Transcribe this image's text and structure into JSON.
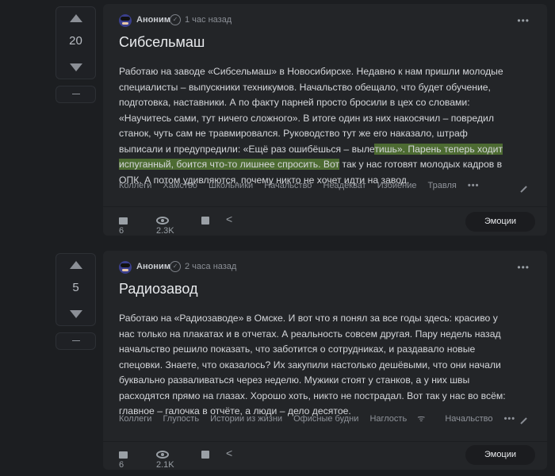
{
  "posts": [
    {
      "score": "20",
      "author": "Аноним",
      "time": "1 час назад",
      "title": "Сибсельмаш",
      "body_before": "Работаю на заводе «Сибсельмаш» в Новосибирске. Недавно к нам пришли молодые специалисты – выпускники техникумов. Начальство обещало, что будет обучение, подготовка, наставники. А по факту парней просто бросили в цех со словами: «Научитесь сами, тут ничего сложного». В итоге один из них накосячил – повредил станок, чуть сам не травмировался. Руководство тут же его наказало, штраф выписали и предупредили: «Ещё раз ошибёшься – выле",
      "body_highlight": "тишь». Парень теперь ходит испуганный, боится что-то лишнее спросить. Вот",
      "body_after": " так у нас готовят молодых кадров в ОПК. А потом удивляются, почему никто не хочет идти на завод.",
      "tags": [
        "Коллеги",
        "Хамство",
        "Школьники",
        "Начальство",
        "Неадекват",
        "Избиение",
        "Травля"
      ],
      "comments": "6",
      "views": "2.3K",
      "emotions_label": "Эмоции"
    },
    {
      "score": "5",
      "author": "Аноним",
      "time": "2 часа назад",
      "title": "Радиозавод",
      "body": "Работаю на «Радиозаводе» в Омске. И вот что я понял за все годы здесь: красиво у нас только на плакатах и в отчетах. А реальность совсем другая. Пару недель назад начальство решило показать, что заботится о сотрудниках, и раздавало новые спецовки. Знаете, что оказалось? Их закупили настолько дешёвыми, что они начали буквально разваливаться через неделю. Мужики стоят у станков, а у них швы расходятся прямо на глазах. Хорошо хоть, никто не пострадал. Вот так у нас во всём: главное – галочка в отчёте, а люди – дело десятое.",
      "tags": [
        "Коллеги",
        "Глупость",
        "Истории из жизни",
        "Офисные будни",
        "Наглость",
        "Начальство"
      ],
      "comments": "6",
      "views": "2.1K",
      "emotions_label": "Эмоции"
    }
  ],
  "icons": {
    "upvote": "arrow-up-icon",
    "downvote": "arrow-down-icon",
    "collapse": "minus-icon",
    "more": "more-horizontal-icon",
    "verified": "check-circle-icon",
    "comments": "comment-icon",
    "views": "eye-icon",
    "save": "save-icon",
    "share": "share-icon",
    "edit": "pencil-icon",
    "rss": "rss-icon"
  },
  "colors": {
    "background": "#1c1e21",
    "card": "#232528",
    "highlight": "#4d6b32"
  }
}
